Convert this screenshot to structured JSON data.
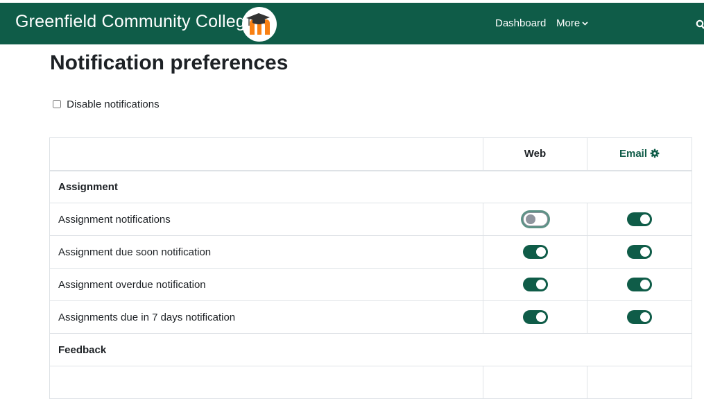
{
  "navbar": {
    "site_name": "Greenfield Community College",
    "links": {
      "dashboard": "Dashboard",
      "more": "More"
    },
    "background_color": "#0f5c48",
    "logo_icon": "moodle-logo-icon",
    "search_icon": "search-icon"
  },
  "page": {
    "title": "Notification preferences",
    "disable_notifications": {
      "label": "Disable notifications",
      "checked": false
    }
  },
  "table": {
    "columns": {
      "web": "Web",
      "email": "Email"
    },
    "email_settings_icon": "gear-icon",
    "groups": [
      {
        "name": "Assignment",
        "items": [
          {
            "label": "Assignment notifications",
            "web": false,
            "email": true
          },
          {
            "label": "Assignment due soon notification",
            "web": true,
            "email": true
          },
          {
            "label": "Assignment overdue notification",
            "web": true,
            "email": true
          },
          {
            "label": "Assignments due in 7 days notification",
            "web": true,
            "email": true
          }
        ]
      },
      {
        "name": "Feedback",
        "items": []
      }
    ]
  },
  "colors": {
    "accent": "#0f5c48",
    "toggle_off_knob": "#8f959e",
    "focus_ring": "#5d9286"
  }
}
